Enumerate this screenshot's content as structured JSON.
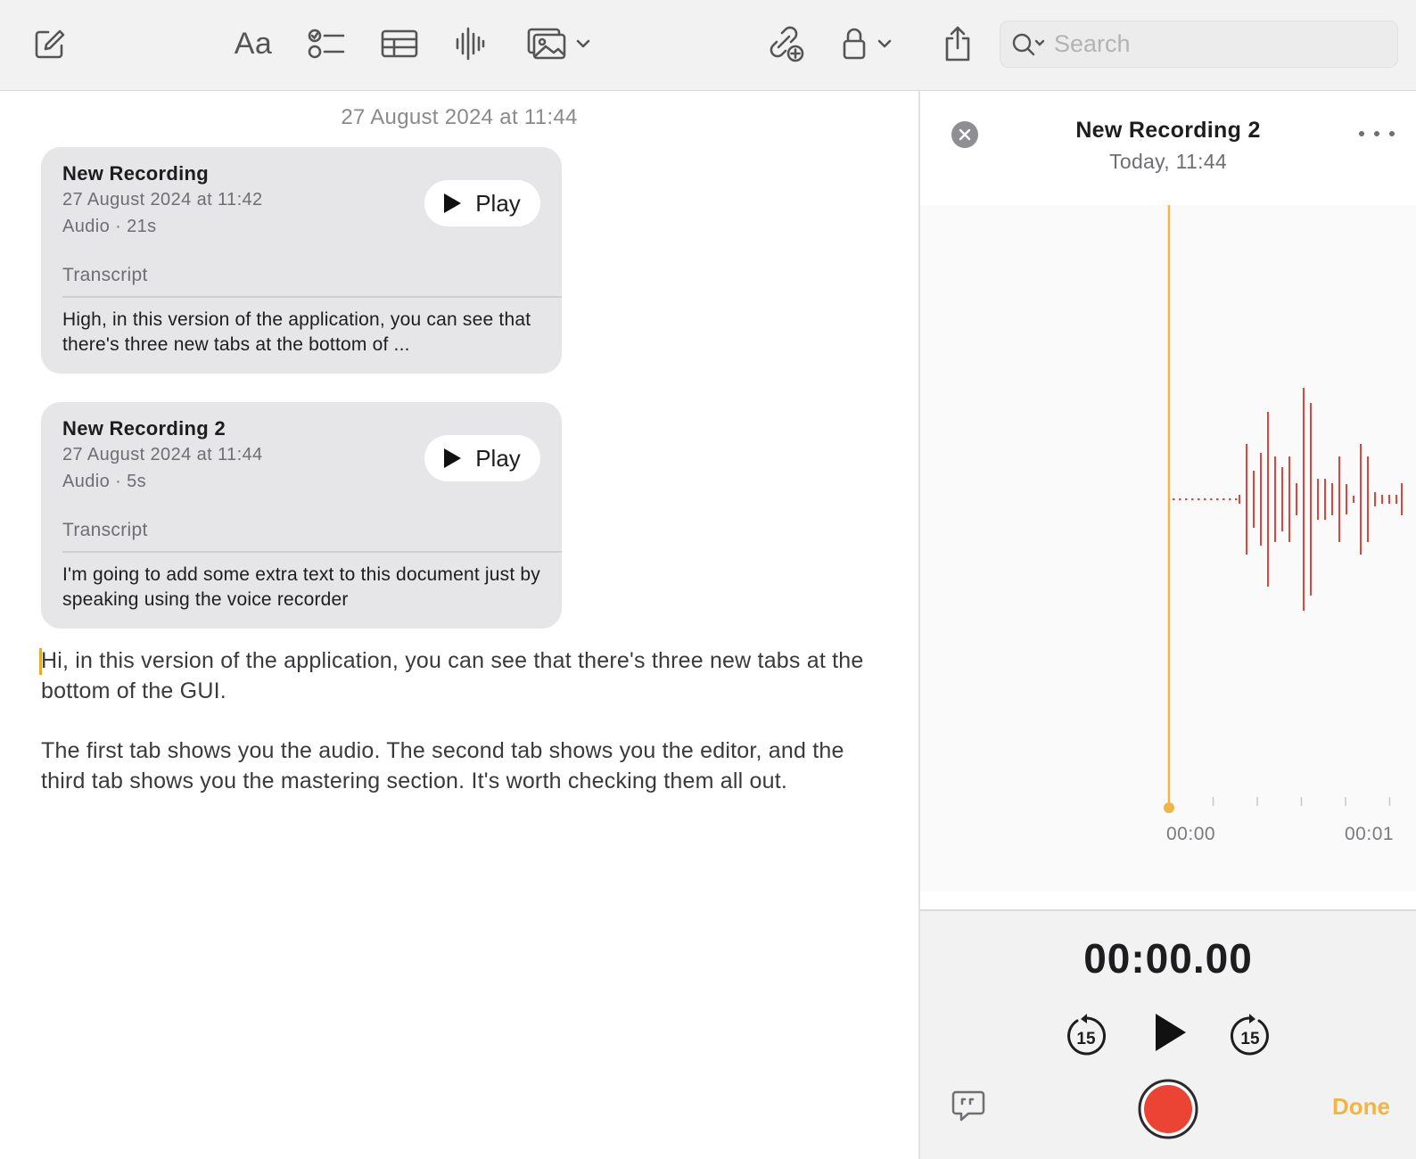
{
  "toolbar": {
    "icons": [
      "compose-icon",
      "format-icon",
      "checklist-icon",
      "table-icon",
      "audio-icon",
      "media-icon",
      "chevron-down-icon",
      "collaborate-icon",
      "lock-icon",
      "chevron-down-icon",
      "share-icon",
      "search-icon"
    ],
    "format_label": "Aa",
    "search_placeholder": "Search",
    "search_value": ""
  },
  "note": {
    "date_header": "27 August 2024 at 11:44",
    "recordings": [
      {
        "title": "New Recording",
        "date": "27 August 2024 at 11:42",
        "meta": "Audio · 21s",
        "play_label": "Play",
        "transcript_label": "Transcript",
        "transcript": "High, in this version of the application, you can see that there's three new tabs at the bottom of ..."
      },
      {
        "title": "New Recording 2",
        "date": "27 August 2024 at 11:44",
        "meta": "Audio · 5s",
        "play_label": "Play",
        "transcript_label": "Transcript",
        "transcript": "I'm going to add some extra text to this document just by speaking using the voice recorder"
      }
    ],
    "paragraphs": [
      "Hi, in this version of the application, you can see that there's three new tabs at the bottom of the GUI.",
      "The first tab shows you the audio. The second tab shows you the editor, and the third tab shows you the mastering section. It's worth checking them all out."
    ]
  },
  "recorder": {
    "title": "New Recording 2",
    "subtitle": "Today, 11:44",
    "time_labels": [
      "00:00",
      "00:01"
    ],
    "timer": "00:00.00",
    "skip_back": "15",
    "skip_forward": "15",
    "done_label": "Done",
    "colors": {
      "playhead": "#f0b545",
      "waveform": "#e0443a",
      "record": "#eb4435",
      "done": "#f0b545"
    }
  }
}
